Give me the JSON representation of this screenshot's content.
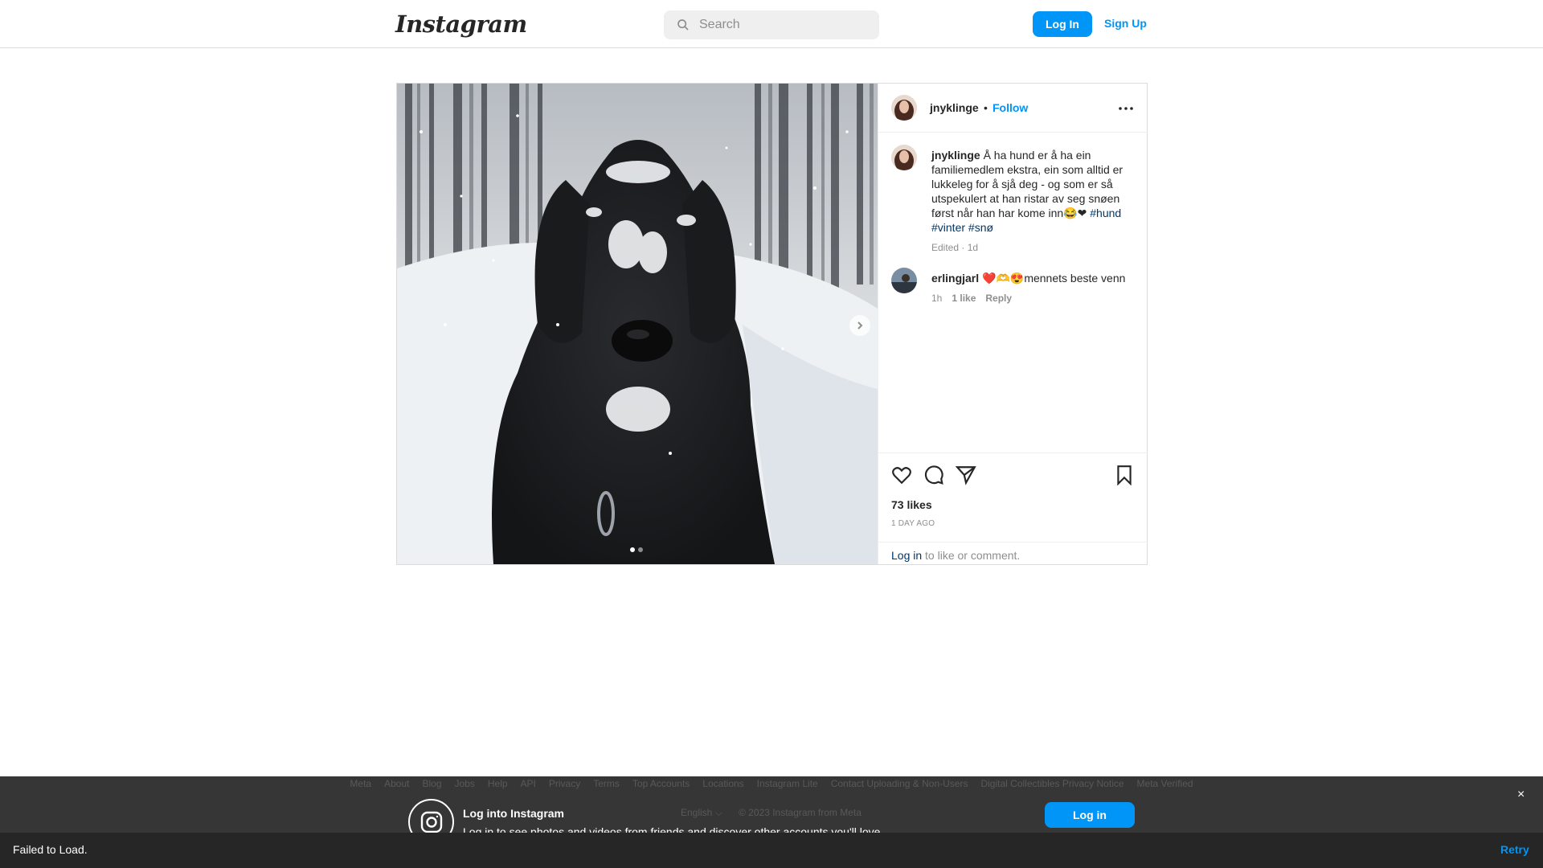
{
  "header": {
    "logo": "Instagram",
    "search_placeholder": "Search",
    "login_label": "Log In",
    "signup_label": "Sign Up"
  },
  "post": {
    "author": "jnyklinge",
    "bullet": "•",
    "follow_label": "Follow",
    "caption_user": "jnyklinge",
    "caption_text": "Å ha hund er å ha ein familiemedlem ekstra, ein som alltid er lukkeleg for å sjå deg - og som er så utspekulert at han ristar av seg snøen først når han har kome inn😂❤",
    "hashtags": [
      "#hund",
      "#vinter",
      "#snø"
    ],
    "caption_meta": "Edited · 1d",
    "comment": {
      "user": "erlingjarl",
      "text": "❤️🫶😍mennets beste venn",
      "time": "1h",
      "likes": "1 like",
      "reply": "Reply"
    },
    "likes": "73 likes",
    "posted_ago": "1 DAY AGO",
    "login_link": "Log in",
    "login_suffix": " to like or comment."
  },
  "footer": {
    "links": [
      "Meta",
      "About",
      "Blog",
      "Jobs",
      "Help",
      "API",
      "Privacy",
      "Terms",
      "Top Accounts",
      "Locations",
      "Instagram Lite",
      "Contact Uploading & Non-Users",
      "Digital Collectibles Privacy Notice",
      "Meta Verified"
    ],
    "language": "English ⌵",
    "copyright": "© 2023 Instagram from Meta",
    "prompt_title": "Log into Instagram",
    "prompt_sub": "Log in to see photos and videos from friends and discover other accounts you'll love.",
    "login_label": "Log in",
    "close_label": "×"
  },
  "error_bar": {
    "message": "Failed to Load.",
    "retry_label": "Retry"
  },
  "colors": {
    "accent": "#0095f6",
    "hashtag": "#00376b",
    "muted": "#8e8e8e"
  }
}
